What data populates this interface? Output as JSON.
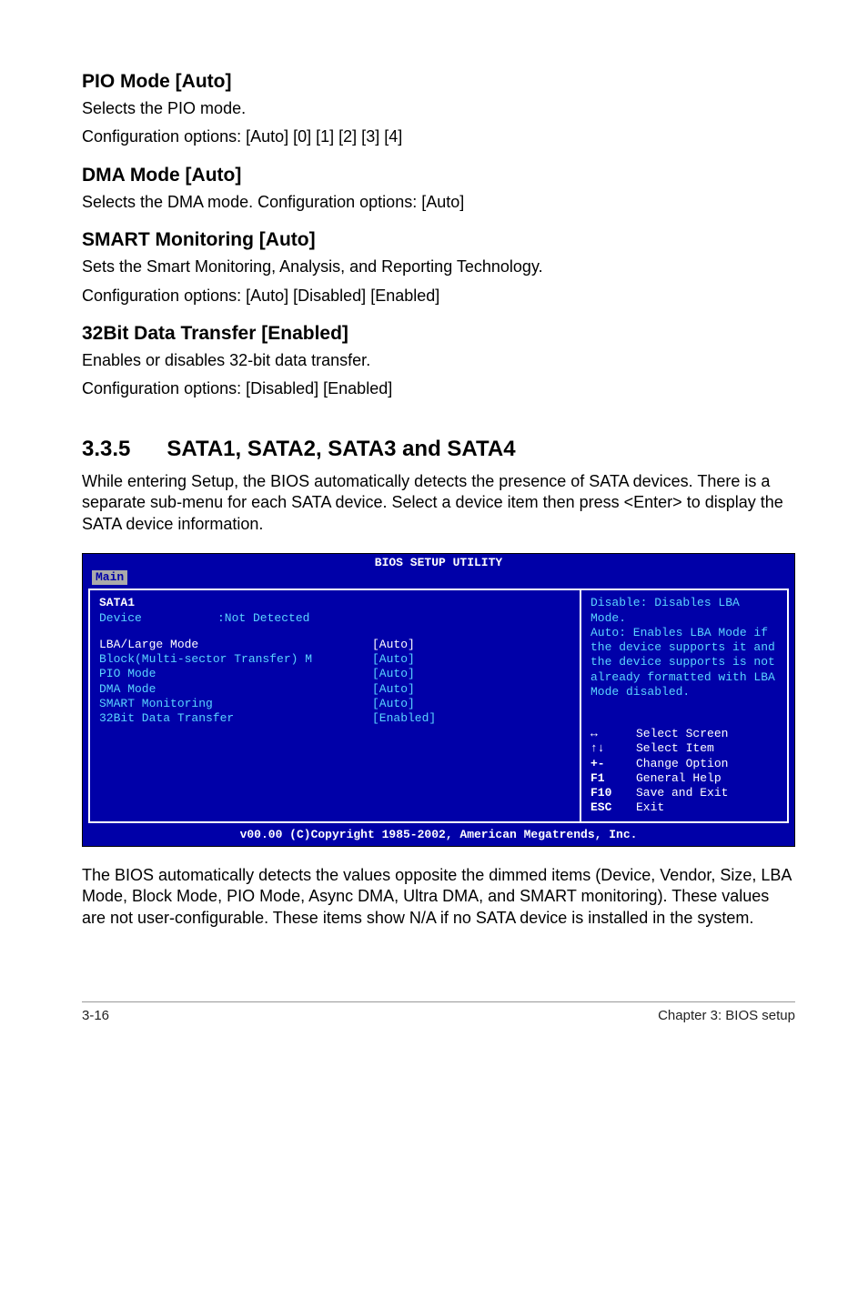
{
  "s1": {
    "title": "PIO Mode [Auto]",
    "p1": "Selects the PIO mode.",
    "p2": "Configuration options: [Auto] [0] [1] [2] [3] [4]"
  },
  "s2": {
    "title": "DMA Mode [Auto]",
    "p1": "Selects the DMA mode. Configuration options: [Auto]"
  },
  "s3": {
    "title": "SMART Monitoring [Auto]",
    "p1": "Sets the Smart Monitoring, Analysis, and Reporting Technology.",
    "p2": "Configuration options: [Auto] [Disabled] [Enabled]"
  },
  "s4": {
    "title": "32Bit Data Transfer [Enabled]",
    "p1": "Enables or disables 32-bit data transfer.",
    "p2": "Configuration options: [Disabled] [Enabled]"
  },
  "sub": {
    "num": "3.3.5",
    "title": "SATA1, SATA2, SATA3 and SATA4",
    "intro": "While entering Setup, the BIOS automatically detects the presence of SATA devices. There is a separate sub-menu for each SATA device. Select a device item then press <Enter> to display the SATA device information."
  },
  "bios": {
    "util_title": "BIOS SETUP UTILITY",
    "tab": "Main",
    "header": "SATA1",
    "device_label": "Device",
    "device_val": ":Not Detected",
    "rows": [
      {
        "label": "LBA/Large Mode",
        "val": "[Auto]",
        "sel": true
      },
      {
        "label": "Block(Multi-sector Transfer) M",
        "val": "[Auto]",
        "sel": false
      },
      {
        "label": "PIO Mode",
        "val": "[Auto]",
        "sel": false
      },
      {
        "label": "DMA Mode",
        "val": "[Auto]",
        "sel": false
      },
      {
        "label": "SMART Monitoring",
        "val": "[Auto]",
        "sel": false
      },
      {
        "label": "32Bit Data Transfer",
        "val": "[Enabled]",
        "sel": false
      }
    ],
    "help": "Disable: Disables LBA Mode.\nAuto: Enables LBA Mode if the device supports it and the device supports is not already formatted with LBA Mode disabled.",
    "nav": [
      {
        "k": "↔",
        "t": "Select Screen"
      },
      {
        "k": "↑↓",
        "t": "Select Item"
      },
      {
        "k": "+-",
        "t": "Change Option"
      },
      {
        "k": "F1",
        "t": "General Help"
      },
      {
        "k": "F10",
        "t": "Save and Exit"
      },
      {
        "k": "ESC",
        "t": "Exit"
      }
    ],
    "copyright": "v00.00 (C)Copyright 1985-2002, American Megatrends, Inc."
  },
  "post_bios": "The BIOS automatically detects the values opposite the dimmed items (Device, Vendor, Size, LBA Mode, Block Mode, PIO Mode, Async DMA, Ultra DMA, and SMART monitoring). These values are not user-configurable. These items show N/A if no SATA device is installed in the system.",
  "footer": {
    "left": "3-16",
    "right": "Chapter 3: BIOS setup"
  }
}
